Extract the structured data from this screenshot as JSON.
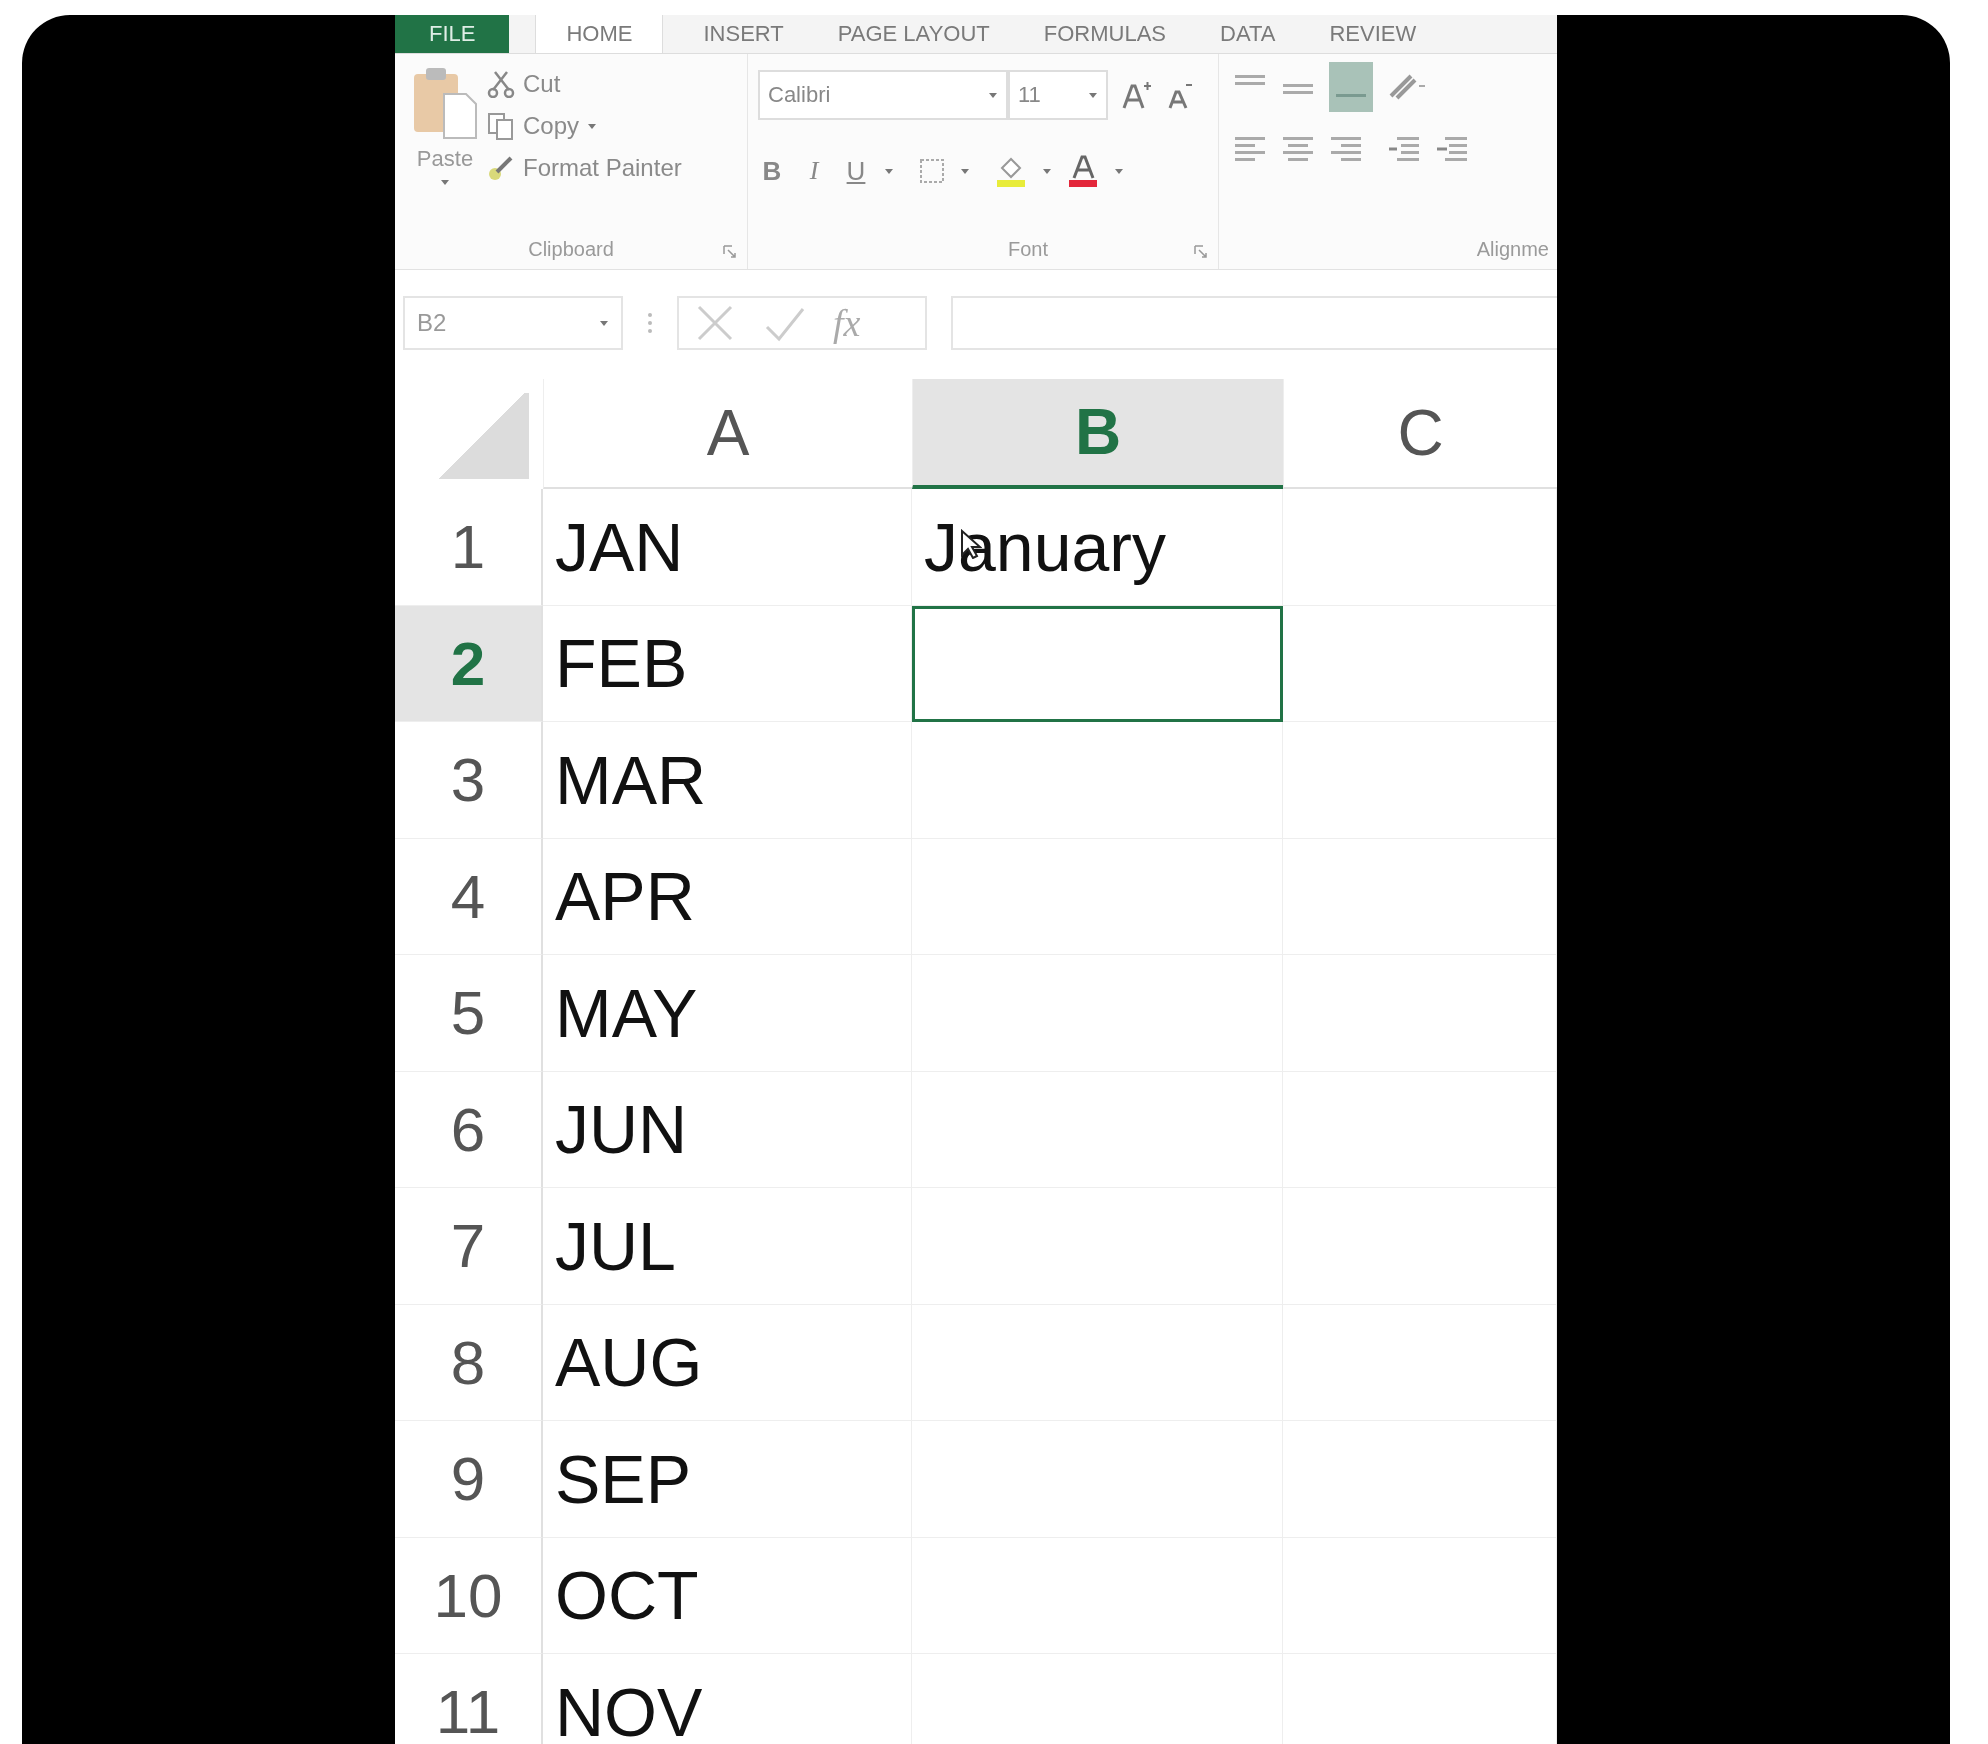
{
  "ribbon": {
    "tabs": [
      {
        "label": "FILE",
        "kind": "file",
        "selected": false
      },
      {
        "label": "HOME",
        "kind": "tab",
        "selected": true
      },
      {
        "label": "INSERT",
        "kind": "tab",
        "selected": false
      },
      {
        "label": "PAGE LAYOUT",
        "kind": "tab",
        "selected": false
      },
      {
        "label": "FORMULAS",
        "kind": "tab",
        "selected": false
      },
      {
        "label": "DATA",
        "kind": "tab",
        "selected": false
      },
      {
        "label": "REVIEW",
        "kind": "tab",
        "selected": false
      }
    ],
    "clipboard": {
      "paste": "Paste",
      "cut": "Cut",
      "copy": "Copy",
      "format_painter": "Format Painter",
      "label": "Clipboard"
    },
    "font": {
      "font_name": "Calibri",
      "font_size": "11",
      "bold": "B",
      "italic": "I",
      "underline": "U",
      "label": "Font"
    },
    "alignment": {
      "label": "Alignme"
    }
  },
  "formula_bar": {
    "name_box": "B2",
    "function": "fx"
  },
  "sheet": {
    "columns": [
      {
        "label": "A",
        "selected": false
      },
      {
        "label": "B",
        "selected": true
      },
      {
        "label": "C",
        "selected": false
      }
    ],
    "rows": [
      {
        "number": "1",
        "selected": false,
        "a": "JAN",
        "b": "January"
      },
      {
        "number": "2",
        "selected": true,
        "a": "FEB"
      },
      {
        "number": "3",
        "selected": false,
        "a": "MAR"
      },
      {
        "number": "4",
        "selected": false,
        "a": "APR"
      },
      {
        "number": "5",
        "selected": false,
        "a": "MAY"
      },
      {
        "number": "6",
        "selected": false,
        "a": "JUN"
      },
      {
        "number": "7",
        "selected": false,
        "a": "JUL"
      },
      {
        "number": "8",
        "selected": false,
        "a": "AUG"
      },
      {
        "number": "9",
        "selected": false,
        "a": "SEP"
      },
      {
        "number": "10",
        "selected": false,
        "a": "OCT"
      },
      {
        "number": "11",
        "selected": false,
        "a": "NOV"
      }
    ]
  }
}
